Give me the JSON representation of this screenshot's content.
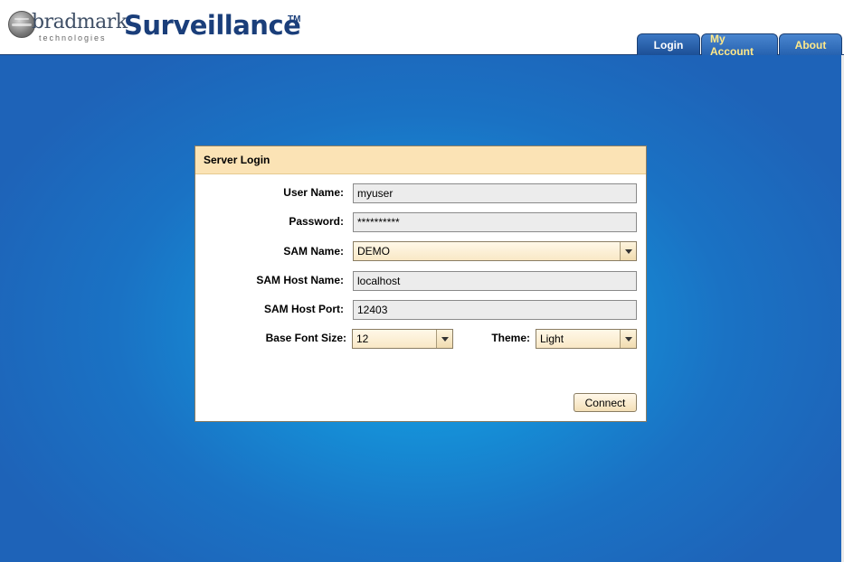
{
  "brand": {
    "logo_name": "bradmark",
    "logo_sub": "technologies",
    "app_title": "Surveillance",
    "trademark": "TM"
  },
  "tabs": [
    {
      "label": "Login",
      "active": true
    },
    {
      "label": "My Account",
      "active": false
    },
    {
      "label": "About",
      "active": false
    }
  ],
  "login": {
    "title": "Server Login",
    "user_name": {
      "label": "User Name:",
      "value": "myuser"
    },
    "password": {
      "label": "Password:",
      "value": "**********"
    },
    "sam_name": {
      "label": "SAM Name:",
      "value": "DEMO"
    },
    "sam_host_name": {
      "label": "SAM Host Name:",
      "value": "localhost"
    },
    "sam_host_port": {
      "label": "SAM Host Port:",
      "value": "12403"
    },
    "base_font_size": {
      "label": "Base Font Size:",
      "value": "12"
    },
    "theme": {
      "label": "Theme:",
      "value": "Light"
    },
    "connect_label": "Connect"
  },
  "colors": {
    "header_text": "#1a3e7a",
    "background_blue": "#1591d8",
    "panel_header": "#fbe3b5",
    "tab_alt_text": "#ffe98a"
  }
}
